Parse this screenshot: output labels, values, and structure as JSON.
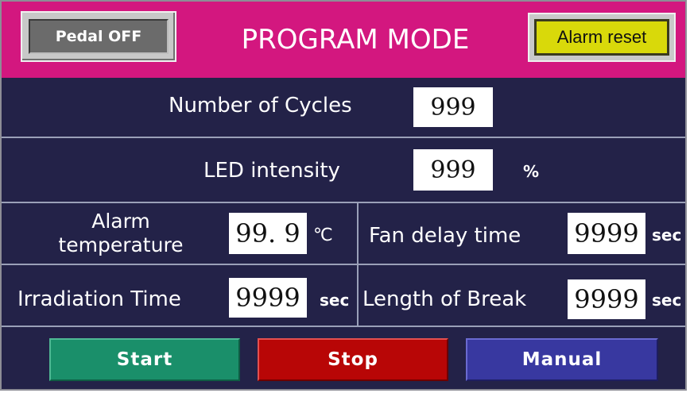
{
  "header": {
    "title": "PROGRAM MODE",
    "pedal_label": "Pedal OFF",
    "alarm_reset_label": "Alarm reset"
  },
  "fields": {
    "cycles": {
      "label": "Number of Cycles",
      "value": "999"
    },
    "led": {
      "label": "LED intensity",
      "value": "999",
      "unit": "%"
    },
    "alarm_temp": {
      "label_line1": "Alarm",
      "label_line2": "temperature",
      "value": "99. 9",
      "unit": "℃"
    },
    "fan_delay": {
      "label": "Fan delay time",
      "value": "9999",
      "unit": "sec"
    },
    "irradiation": {
      "label": "Irradiation Time",
      "value": "9999",
      "unit": "sec"
    },
    "break_length": {
      "label": "Length of Break",
      "value": "9999",
      "unit": "sec"
    }
  },
  "buttons": {
    "start": "Start",
    "stop": "Stop",
    "manual": "Manual"
  },
  "colors": {
    "background": "#232248",
    "header": "#d3177f",
    "start": "#1a8f6a",
    "stop": "#b80606",
    "manual": "#3838a0",
    "alarm": "#d9d90a"
  }
}
